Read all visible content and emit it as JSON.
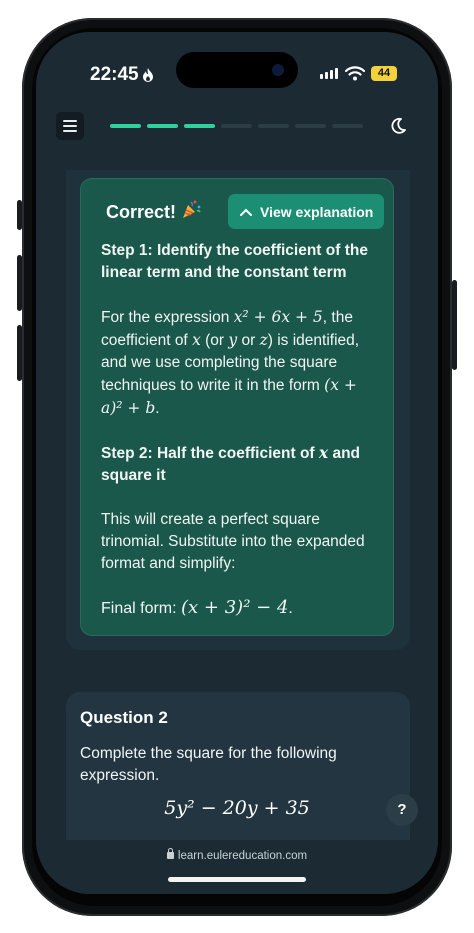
{
  "status_bar": {
    "time": "22:45",
    "battery": "44"
  },
  "progress": {
    "completed_steps": 3,
    "total_steps": 7
  },
  "explanation": {
    "correct_label": "Correct!",
    "view_button_label": "View explanation",
    "step1_title": "Step 1: Identify the coefficient of the linear term and the constant term",
    "step1_body": {
      "p1": "For the expression",
      "expr": "x² + 6x + 5",
      "p2": ", the coefficient of",
      "var_x": "x",
      "p3": "(or",
      "var_y": "y",
      "p4": "or",
      "var_z": "z",
      "p5": ") is identified, and we use completing the square techniques to write it in the form",
      "form": "(x + a)² + b",
      "p6": "."
    },
    "step2_title": {
      "p1": "Step 2: Half the coefficient of",
      "var": "x",
      "p2": "and square it"
    },
    "step2_body": "This will create a perfect square trinomial. Substitute into the expanded format and simplify:",
    "final": {
      "label": "Final form:",
      "expr": "(x + 3)² − 4",
      "end": "."
    }
  },
  "question": {
    "title": "Question 2",
    "text": "Complete the square for the following expression.",
    "expression": "5y² − 20y + 35",
    "help_label": "?"
  },
  "browser": {
    "url": "learn.eulereducation.com"
  },
  "colors": {
    "accent": "#2fd19a",
    "card": "#1a584b",
    "button": "#1c8e74",
    "background": "#1b2a33"
  }
}
